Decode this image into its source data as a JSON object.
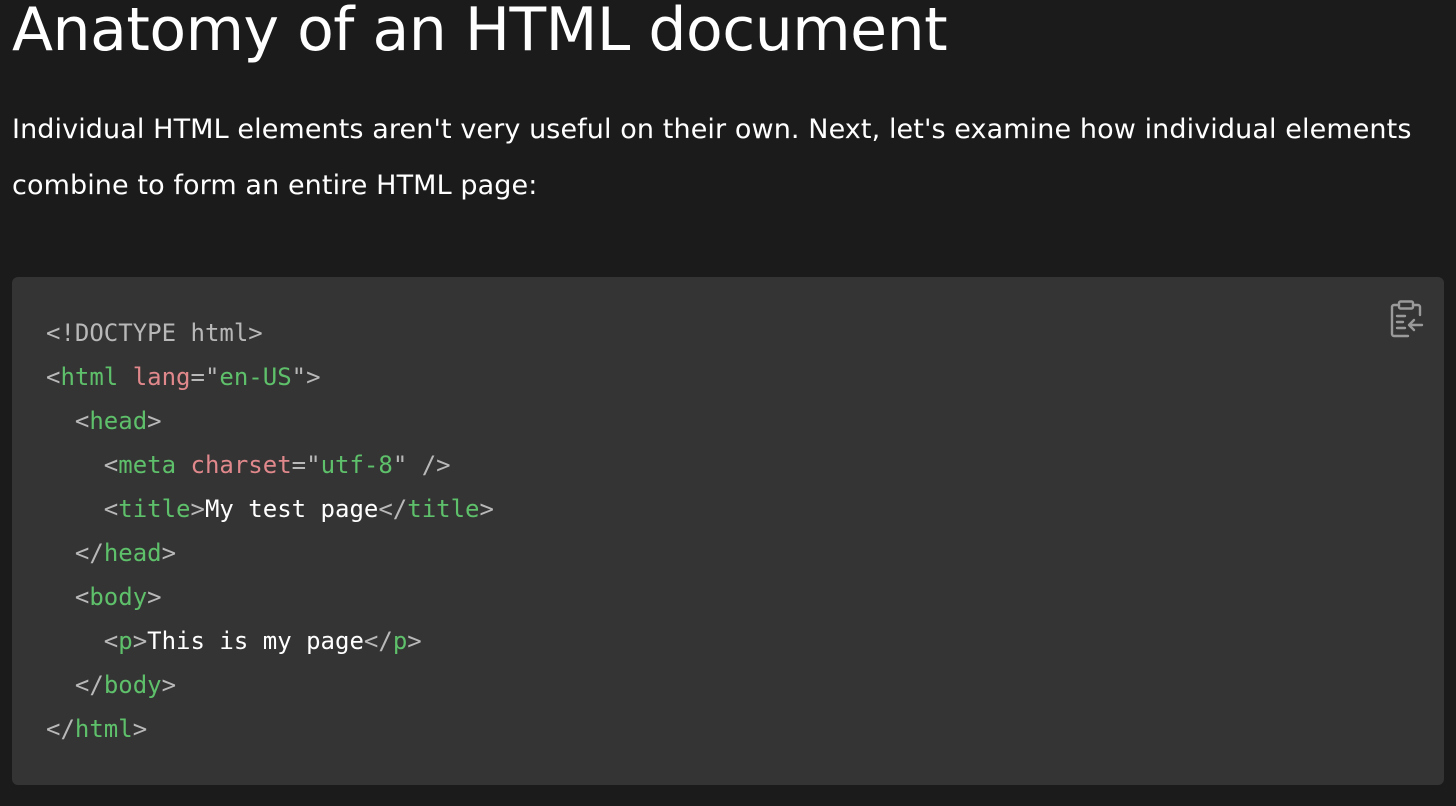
{
  "article": {
    "heading": "Anatomy of an HTML document",
    "intro": "Individual HTML elements aren't very useful on their own. Next, let's examine how individual elements combine to form an entire HTML page:"
  },
  "code_block": {
    "copy_icon": "copy-to-clipboard-icon",
    "lines": {
      "l1": {
        "doctype": "<!DOCTYPE html>"
      },
      "l2": {
        "open": "<",
        "tag": "html",
        "sp": " ",
        "attr": "lang",
        "eq": "=\"",
        "val": "en-US",
        "close": "\">"
      },
      "l3": {
        "indent": "  ",
        "open": "<",
        "tag": "head",
        "close": ">"
      },
      "l4": {
        "indent": "    ",
        "open": "<",
        "tag": "meta",
        "sp": " ",
        "attr": "charset",
        "eq": "=\"",
        "val": "utf-8",
        "close": "\" />"
      },
      "l5": {
        "indent": "    ",
        "open": "<",
        "tag": "title",
        "close": ">",
        "text": "My test page",
        "end_open": "</",
        "end_tag": "title",
        "end_close": ">"
      },
      "l6": {
        "indent": "  ",
        "open": "</",
        "tag": "head",
        "close": ">"
      },
      "l7": {
        "indent": "  ",
        "open": "<",
        "tag": "body",
        "close": ">"
      },
      "l8": {
        "indent": "    ",
        "open": "<",
        "tag": "p",
        "close": ">",
        "text": "This is my page",
        "end_open": "</",
        "end_tag": "p",
        "end_close": ">"
      },
      "l9": {
        "indent": "  ",
        "open": "</",
        "tag": "body",
        "close": ">"
      },
      "l10": {
        "open": "</",
        "tag": "html",
        "close": ">"
      }
    }
  },
  "colors": {
    "background": "#1b1b1b",
    "code_background": "#343434",
    "tag": "#5ec06a",
    "attribute": "#e0888b",
    "punctuation": "#b8b8b8",
    "text": "#ffffff"
  }
}
